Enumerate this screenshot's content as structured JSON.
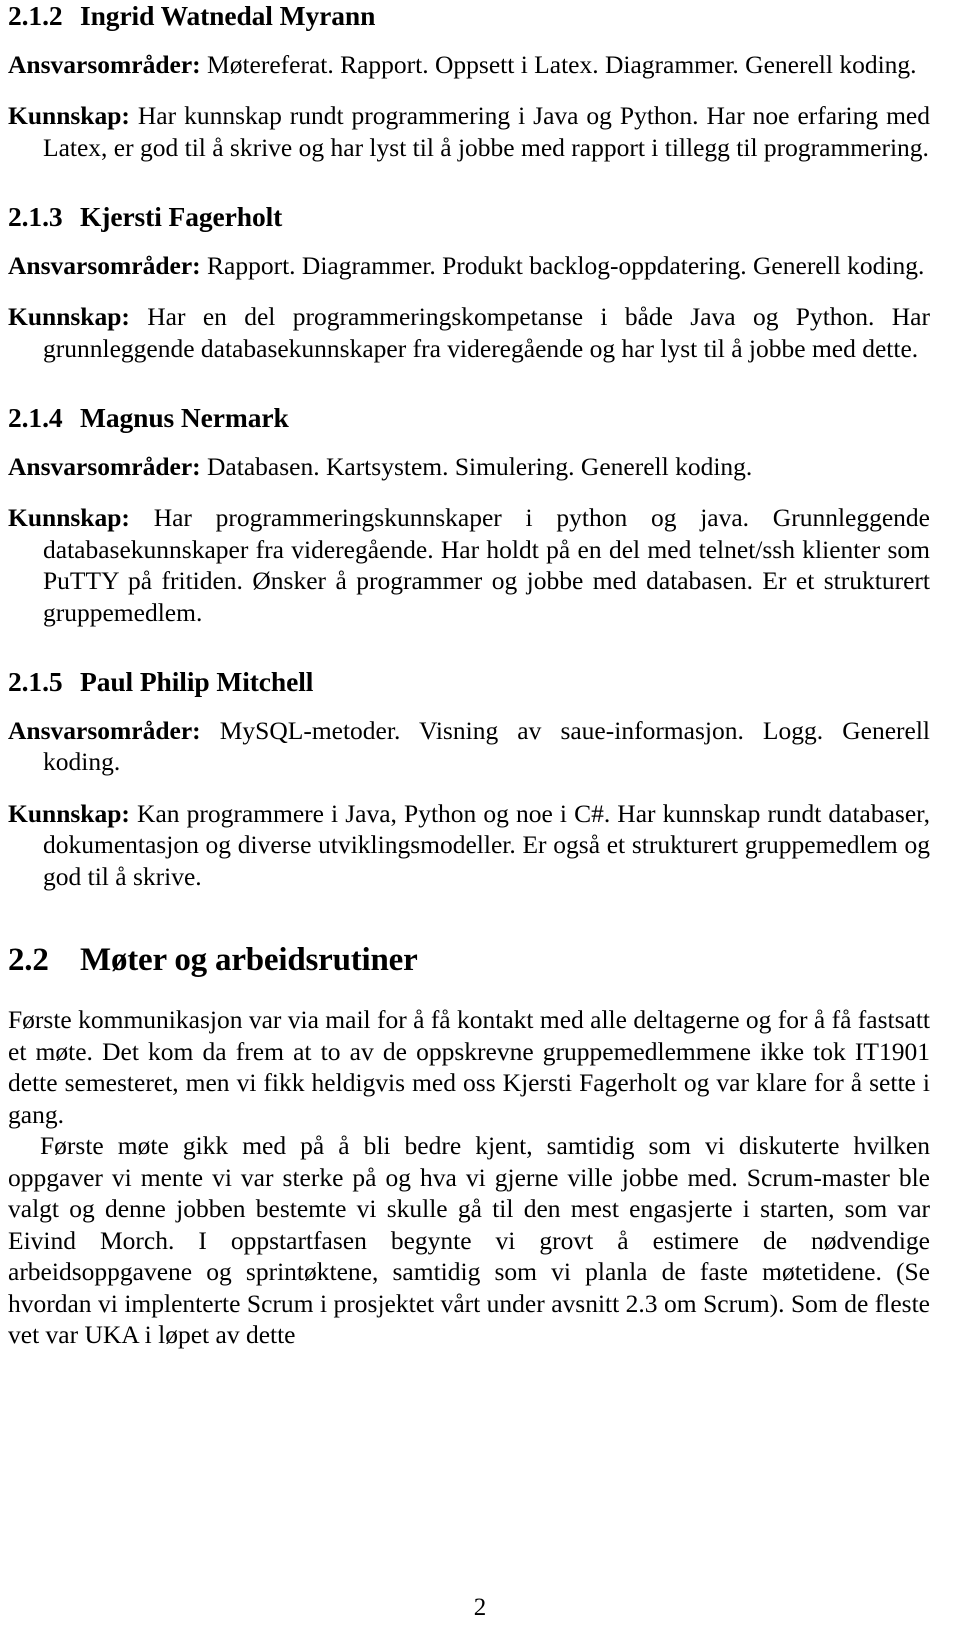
{
  "document": {
    "page_number": "2",
    "language": "Norwegian"
  },
  "entries": [
    {
      "number": "2.1.2",
      "title": "Ingrid Watnedal Myrann",
      "responsibilities_term": "Ansvarsområder:",
      "responsibilities_text": "Møtereferat. Rapport. Oppsett i Latex. Diagrammer. Generell koding.",
      "knowledge_term": "Kunnskap:",
      "knowledge_text": "Har kunnskap rundt programmering i Java og Python. Har noe erfaring med Latex, er god til å skrive og har lyst til å jobbe med rapport i tillegg til programmering."
    },
    {
      "number": "2.1.3",
      "title": "Kjersti Fagerholt",
      "responsibilities_term": "Ansvarsområder:",
      "responsibilities_text": "Rapport. Diagrammer. Produkt backlog-oppdatering. Generell koding.",
      "knowledge_term": "Kunnskap:",
      "knowledge_text": "Har en del programmeringskompetanse i både Java og Python. Har grunnleggende databasekunnskaper fra videregående og har lyst til å jobbe med dette."
    },
    {
      "number": "2.1.4",
      "title": "Magnus Nermark",
      "responsibilities_term": "Ansvarsområder:",
      "responsibilities_text": "Databasen. Kartsystem. Simulering. Generell koding.",
      "knowledge_term": "Kunnskap:",
      "knowledge_text": "Har programmeringskunnskaper i python og java. Grunnleggende databasekunnskaper fra videregående. Har holdt på en del med telnet/ssh klienter som PuTTY på fritiden. Ønsker å programmer og jobbe med databasen. Er et strukturert gruppemedlem."
    },
    {
      "number": "2.1.5",
      "title": "Paul Philip Mitchell",
      "responsibilities_term": "Ansvarsområder:",
      "responsibilities_text": "MySQL-metoder. Visning av saue-informasjon. Logg. Generell koding.",
      "knowledge_term": "Kunnskap:",
      "knowledge_text": "Kan programmere i Java, Python og noe i C#. Har kunnskap rundt databaser, dokumentasjon og diverse utviklingsmodeller. Er også et strukturert gruppemedlem og god til å skrive."
    }
  ],
  "section": {
    "number": "2.2",
    "title": "Møter og arbeidsrutiner",
    "paragraphs": [
      "Første kommunikasjon var via mail for å få kontakt med alle deltagerne og for å få fastsatt et møte. Det kom da frem at to av de oppskrevne gruppemedlemmene ikke tok IT1901 dette semesteret, men vi fikk heldigvis med oss Kjersti Fagerholt og var klare for å sette i gang.",
      "Første møte gikk med på å bli bedre kjent, samtidig som vi diskuterte hvilken oppgaver vi mente vi var sterke på og hva vi gjerne ville jobbe med. Scrum-master ble valgt og denne jobben bestemte vi skulle gå til den mest engasjerte i starten, som var Eivind Morch. I oppstartfasen begynte vi grovt å estimere de nødvendige arbeidsoppgavene og sprintøktene, samtidig som vi planla de faste møtetidene. (Se hvordan vi implenterte Scrum i prosjektet vårt under avsnitt 2.3 om Scrum). Som de fleste vet var UKA i løpet av dette"
    ]
  }
}
